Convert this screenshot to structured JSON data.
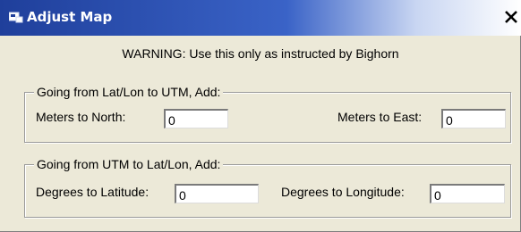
{
  "window": {
    "title": "Adjust Map",
    "close_label": "×"
  },
  "warning": "WARNING: Use this only as instructed by Bighorn",
  "latlon_to_utm": {
    "legend": "Going from Lat/Lon to UTM, Add:",
    "north_label": "Meters to North:",
    "north_value": "0",
    "east_label": "Meters to East:",
    "east_value": "0"
  },
  "utm_to_latlon": {
    "legend": "Going from UTM to Lat/Lon, Add:",
    "lat_label": "Degrees to Latitude:",
    "lat_value": "0",
    "lon_label": "Degrees to Longitude:",
    "lon_value": "0"
  },
  "icons": {
    "title": "app-icon",
    "close": "close-icon"
  },
  "colors": {
    "titlebar_start": "#1f3f9b",
    "titlebar_end": "#ffffff",
    "dialog_background": "#ece9d8"
  }
}
